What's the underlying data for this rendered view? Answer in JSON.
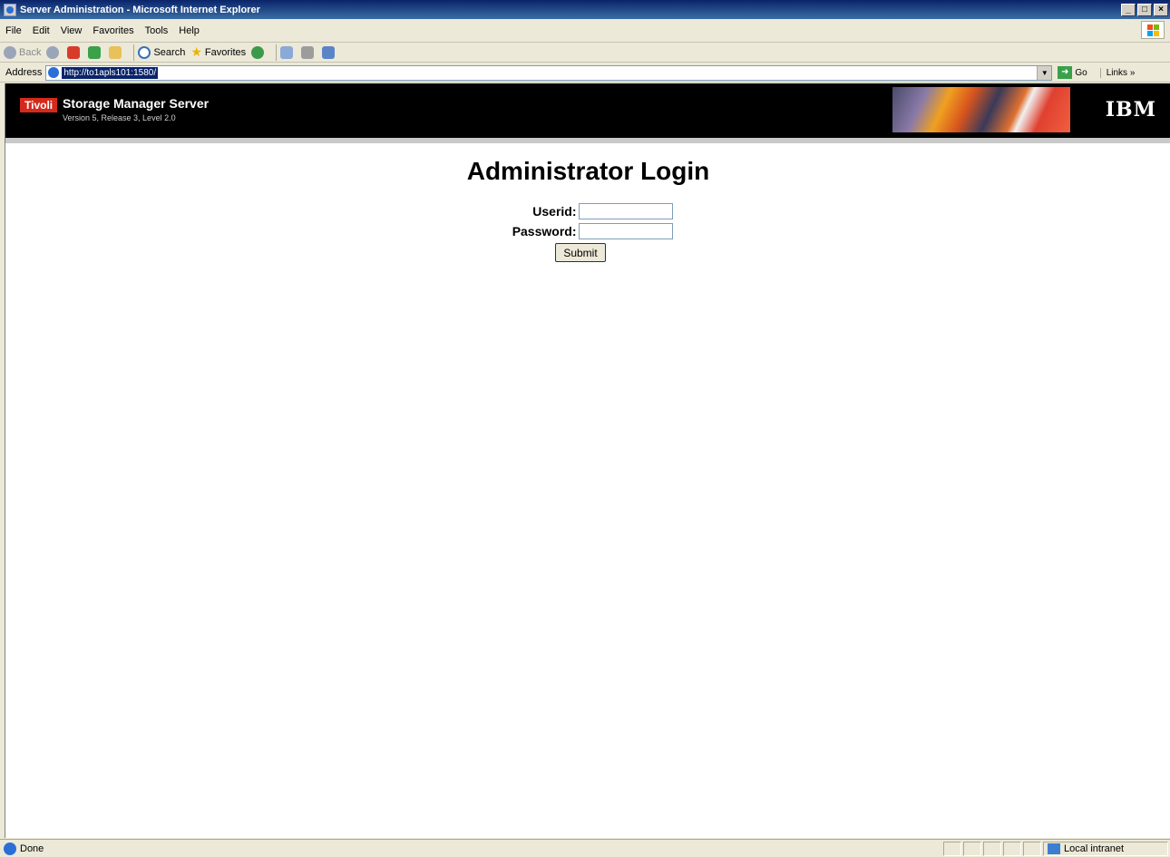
{
  "window": {
    "title": "Server Administration - Microsoft Internet Explorer",
    "controls": {
      "minimize": "_",
      "maximize": "□",
      "close": "×"
    }
  },
  "menu": [
    "File",
    "Edit",
    "View",
    "Favorites",
    "Tools",
    "Help"
  ],
  "toolbar": {
    "back": "Back",
    "search": "Search",
    "favorites": "Favorites"
  },
  "address": {
    "label": "Address",
    "url": "http://to1apls101:1580/",
    "go": "Go",
    "links": "Links"
  },
  "banner": {
    "logo": "Tivoli",
    "product": "Storage Manager Server",
    "version": "Version 5, Release 3, Level 2.0",
    "ibm": "IBM"
  },
  "login": {
    "title": "Administrator Login",
    "userid_label": "Userid:",
    "password_label": "Password:",
    "submit": "Submit"
  },
  "status": {
    "text": "Done",
    "zone": "Local intranet"
  }
}
